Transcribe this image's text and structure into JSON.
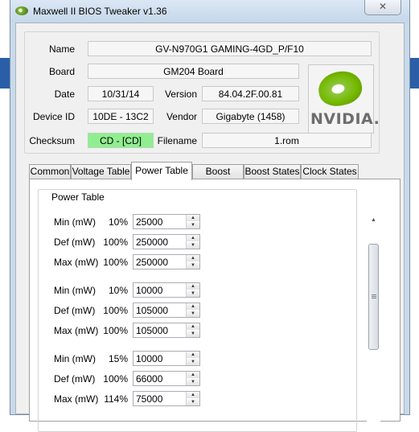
{
  "window": {
    "title": "Maxwell II BIOS Tweaker v1.36",
    "close_glyph": "✕"
  },
  "info": {
    "name_label": "Name",
    "name_value": "GV-N970G1 GAMING-4GD_P/F10",
    "board_label": "Board",
    "board_value": "GM204 Board",
    "date_label": "Date",
    "date_value": "10/31/14",
    "version_label": "Version",
    "version_value": "84.04.2F.00.81",
    "device_label": "Device ID",
    "device_value": "10DE - 13C2",
    "vendor_label": "Vendor",
    "vendor_value": "Gigabyte (1458)",
    "checksum_label": "Checksum",
    "checksum_value": "CD - [CD]",
    "filename_label": "Filename",
    "filename_value": "1.rom",
    "logo_text": "NVIDIA."
  },
  "tabs": [
    "Common",
    "Voltage Table",
    "Power Table",
    "Boost Table",
    "Boost States",
    "Clock States"
  ],
  "active_tab": "Power Table",
  "power_table": {
    "title": "Power Table",
    "rows": [
      {
        "label": "Min (mW)",
        "pct": "10%",
        "value": "25000"
      },
      {
        "label": "Def (mW)",
        "pct": "100%",
        "value": "250000"
      },
      {
        "label": "Max (mW)",
        "pct": "100%",
        "value": "250000"
      },
      {
        "label": "Min (mW)",
        "pct": "10%",
        "value": "10000"
      },
      {
        "label": "Def (mW)",
        "pct": "100%",
        "value": "105000"
      },
      {
        "label": "Max (mW)",
        "pct": "100%",
        "value": "105000"
      },
      {
        "label": "Min (mW)",
        "pct": "15%",
        "value": "10000"
      },
      {
        "label": "Def (mW)",
        "pct": "100%",
        "value": "66000"
      },
      {
        "label": "Max (mW)",
        "pct": "114%",
        "value": "75000"
      }
    ]
  },
  "colors": {
    "checksum_ok": "#90ee90",
    "nvidia_green": "#76b900"
  },
  "icons": {
    "app": "nvidia-eye-icon",
    "spin_up": "spin-up-icon",
    "spin_down": "spin-down-icon"
  }
}
